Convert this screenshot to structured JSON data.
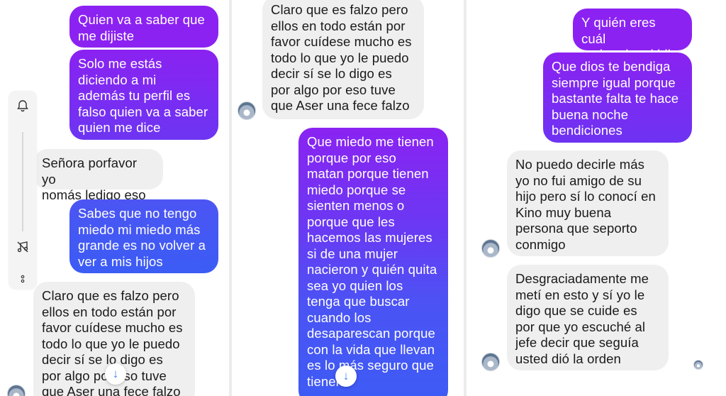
{
  "colors": {
    "incoming_bg": "#efefef",
    "outgoing_purple": "#8b22f2",
    "outgoing_blue": "#3d5bf5",
    "scroll_arrow": "#3b82f6"
  },
  "toolbar": {
    "icons": [
      "bell-icon",
      "music-icon",
      "more-options-icon"
    ]
  },
  "panels": [
    {
      "messages": [
        {
          "text": "Quien va a saber que\nme dijiste"
        },
        {
          "text": "Solo me estás\ndiciendo a mi\nademás tu perfil es\nfalso quien va a saber\nquien me dice"
        },
        {
          "text": "Señora porfavor yo\nnomás ledigo eso"
        },
        {
          "text": "Sabes que no tengo\nmiedo mi miedo más\ngrande es no volver a\nver a mis hijos"
        },
        {
          "text": "Claro que es falzo pero\nellos en todo están por\nfavor cuídese mucho es\ntodo lo que yo le puedo\ndecir sí se lo digo es\npor algo por eso tuve\nque Aser una fece falzo"
        }
      ]
    },
    {
      "messages": [
        {
          "text": "Claro que es falzo pero\nellos en todo están por\nfavor cuídese mucho es\ntodo lo que yo le puedo\ndecir sí se lo digo es\npor algo por eso tuve\nque Aser una fece falzo"
        },
        {
          "text": "Que miedo me tienen\nporque por eso\nmatan porque tienen\nmiedo porque se\nsienten menos o\nporque que les\nhacemos las mujeres\nsi de una mujer\nnacieron y quién quita\nsea yo quien los\ntenga que buscar\ncuando los\ndesaparescan porque\ncon la vida que llevan\nes lo más seguro que\ntienen"
        }
      ]
    },
    {
      "messages": [
        {
          "text": "Y quién eres cuál\namigo de mi hijo"
        },
        {
          "text": "Que dios te bendiga\nsiempre igual porque\nbastante falta te hace\nbuena noche\nbendiciones"
        },
        {
          "text": "No puedo decirle más\nyo no fui amigo de su\nhijo pero sí lo conocí en\nKino muy buena\npersona que seporto\nconmigo"
        },
        {
          "text": "Desgraciadamente me\nmetí en esto y sí yo le\ndigo que se cuide es\npor que yo escuché al\njefe decir que seguía\nusted dió la orden"
        }
      ]
    }
  ],
  "scroll_down_icon": "arrow-down-icon"
}
